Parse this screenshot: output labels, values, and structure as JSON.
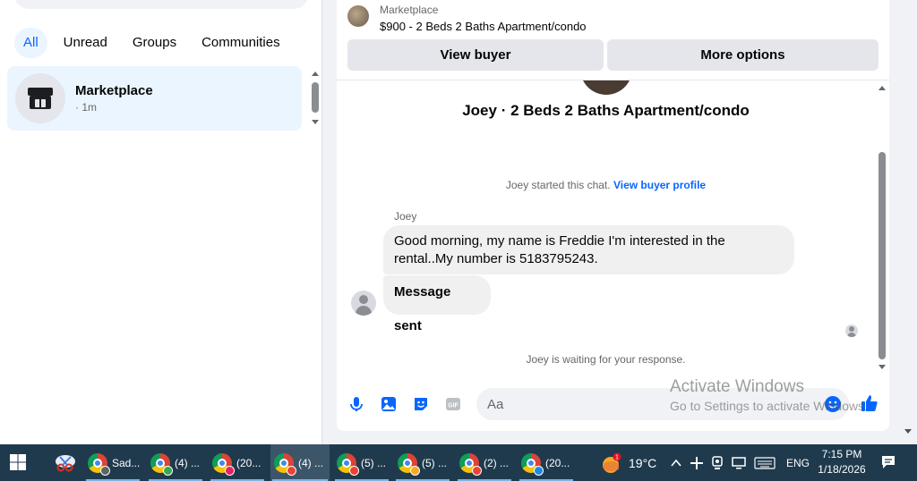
{
  "left_panel": {
    "tabs": [
      {
        "label": "All",
        "active": true
      },
      {
        "label": "Unread",
        "active": false
      },
      {
        "label": "Groups",
        "active": false
      },
      {
        "label": "Communities",
        "active": false
      }
    ],
    "conversations": [
      {
        "name": "Marketplace",
        "time": "· 1m"
      }
    ]
  },
  "chat": {
    "header": {
      "source": "Marketplace",
      "listing_title": "$900 - 2 Beds 2 Baths Apartment/condo",
      "view_buyer": "View buyer",
      "more_options": "More options"
    },
    "title": "Joey · 2 Beds 2 Baths Apartment/condo",
    "started_text": "Joey started this chat.",
    "view_buyer_profile": "View buyer profile",
    "sender_name": "Joey",
    "messages": [
      {
        "text": "Good morning, my name is Freddie I'm interested in the rental..My number is 5183795243."
      },
      {
        "text": "Message sent"
      }
    ],
    "waiting_text": "Joey is waiting for your response.",
    "composer": {
      "placeholder": "Aa"
    }
  },
  "watermark": {
    "line1": "Activate Windows",
    "line2": "Go to Settings to activate Windows."
  },
  "taskbar": {
    "items": [
      {
        "label": "Sad...",
        "badge_color": "#5f6368",
        "badge_letter": "C"
      },
      {
        "label": "(4) ...",
        "badge_color": "#34a853"
      },
      {
        "label": "(20...",
        "badge_color": "#e91e63"
      },
      {
        "label": "(4) ...",
        "badge_color": "#ea4335"
      },
      {
        "label": "(5) ...",
        "badge_color": "#ea4335"
      },
      {
        "label": "(5) ...",
        "badge_color": "#f9a825"
      },
      {
        "label": "(2) ...",
        "badge_color": "#ea4335"
      },
      {
        "label": "(20...",
        "badge_color": "#1e88e5"
      }
    ],
    "weather": {
      "temp": "19°C",
      "badge": "1"
    },
    "language": "ENG",
    "time": "7:15 PM",
    "date": "1/18/2026"
  },
  "colors": {
    "accent": "#0866ff",
    "selected_bg": "#ebf5ff",
    "bubble_bg": "#f0f0f0",
    "taskbar_bg": "#1f3a4d"
  }
}
